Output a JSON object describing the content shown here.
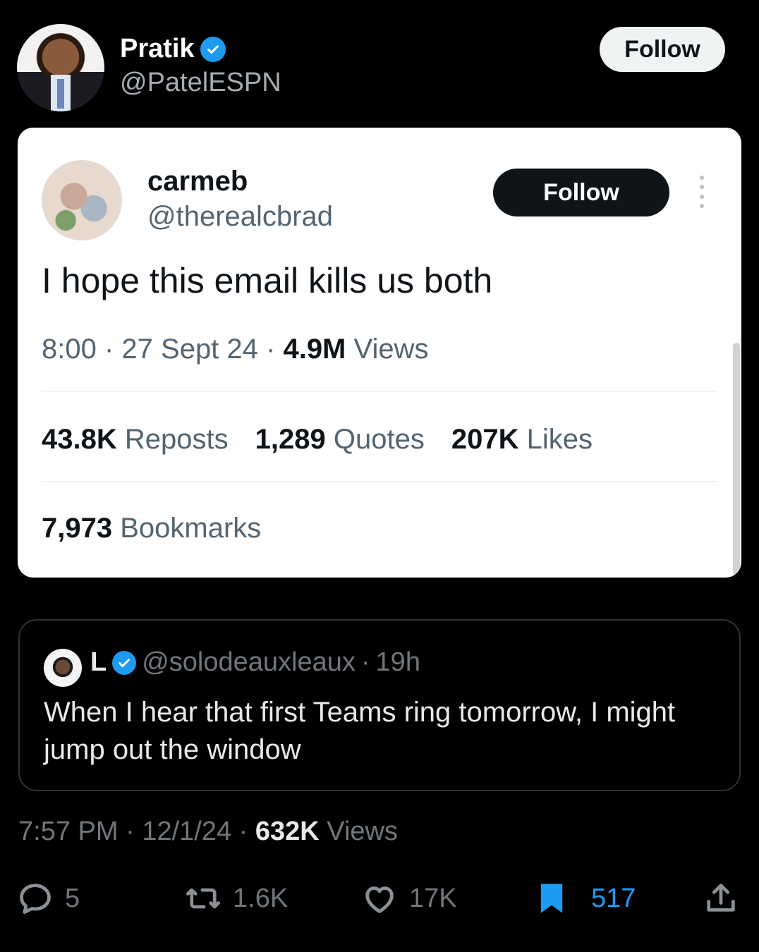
{
  "author": {
    "name": "Pratik",
    "handle": "@PatelESPN",
    "follow_label": "Follow"
  },
  "embedded_tweet": {
    "name": "carmeb",
    "handle": "@therealcbrad",
    "follow_label": "Follow",
    "text": "I hope this email kills us both",
    "time": "8:00",
    "date": "27 Sept 24",
    "views_count": "4.9M",
    "views_label": "Views",
    "reposts_count": "43.8K",
    "reposts_label": "Reposts",
    "quotes_count": "1,289",
    "quotes_label": "Quotes",
    "likes_count": "207K",
    "likes_label": "Likes",
    "bookmarks_count": "7,973",
    "bookmarks_label": "Bookmarks"
  },
  "quoted_tweet": {
    "name": "L",
    "handle": "@solodeauxleaux",
    "age": "19h",
    "text": "When I hear that first Teams ring tomorrow, I might jump out the window"
  },
  "meta": {
    "time": "7:57 PM",
    "date": "12/1/24",
    "views_count": "632K",
    "views_label": "Views"
  },
  "actions": {
    "replies": "5",
    "reposts": "1.6K",
    "likes": "17K",
    "bookmarks": "517"
  },
  "colors": {
    "accent": "#1d9bf0",
    "background": "#000000",
    "muted": "#71767b"
  }
}
